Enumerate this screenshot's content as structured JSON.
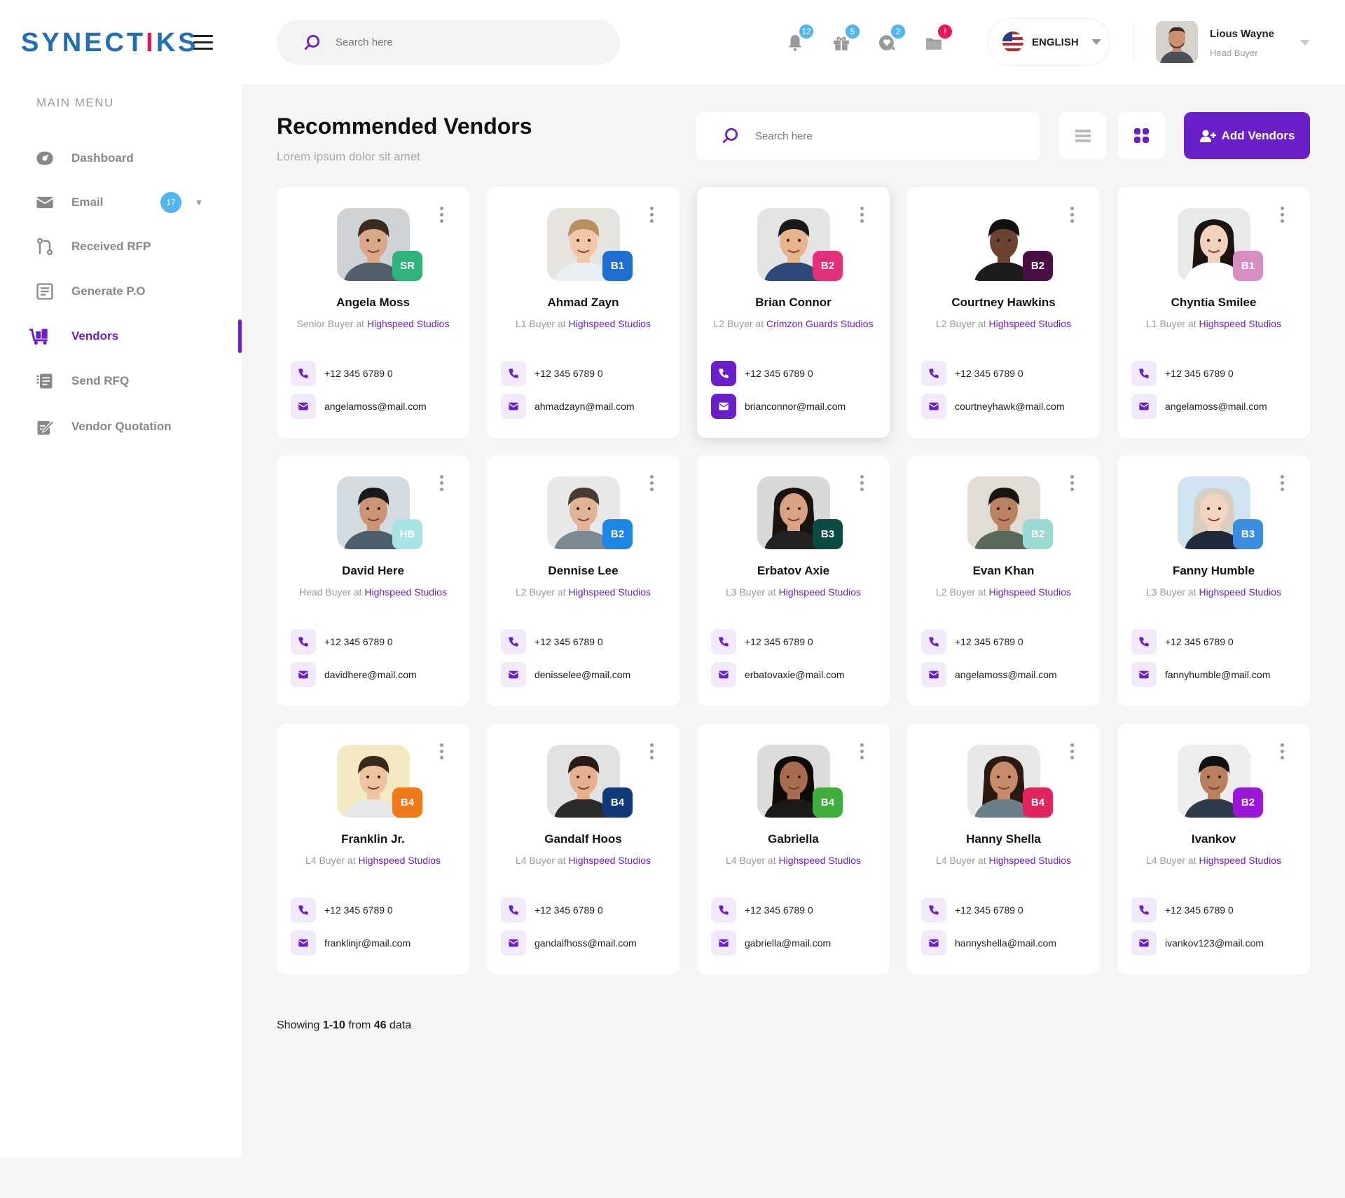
{
  "app": {
    "logo_main": "SYNECT",
    "logo_i": "I",
    "logo_tail": "KS"
  },
  "sidebar": {
    "menu_title": "MAIN MENU",
    "items": [
      {
        "label": "Dashboard",
        "icon": "dashboard-icon"
      },
      {
        "label": "Email",
        "icon": "email-icon",
        "badge": "17"
      },
      {
        "label": "Received RFP",
        "icon": "received-rfp-icon"
      },
      {
        "label": "Generate P.O",
        "icon": "generate-po-icon"
      },
      {
        "label": "Vendors",
        "icon": "vendors-icon",
        "active": true
      },
      {
        "label": "Send RFQ",
        "icon": "send-rfq-icon"
      },
      {
        "label": "Vendor Quotation",
        "icon": "vendor-quotation-icon"
      }
    ]
  },
  "header": {
    "search_placeholder": "Search here",
    "notifications": [
      {
        "icon": "bell-icon",
        "count": "12",
        "color": "#4fb7ee"
      },
      {
        "icon": "gift-icon",
        "count": "5",
        "color": "#4fb7ee"
      },
      {
        "icon": "heart-chat-icon",
        "count": "2",
        "color": "#4fb7ee"
      },
      {
        "icon": "folder-icon",
        "count": "!",
        "color": "#e6195d"
      }
    ],
    "language": "ENGLISH",
    "user": {
      "name": "Lious Wayne",
      "role": "Head Buyer"
    }
  },
  "page": {
    "title": "Recommended Vendors",
    "subtitle": "Lorem ipsum  dolor sit amet",
    "search_placeholder": "Search here",
    "add_button": "Add Vendors"
  },
  "vendors": [
    {
      "name": "Angela Moss",
      "role": "Senior Buyer  at",
      "company": "Highspeed Studios",
      "tier": "SR",
      "tier_color": "#2fb37a",
      "phone": "+12 345 6789 0",
      "email": "angelamoss@mail.com"
    },
    {
      "name": "Ahmad Zayn",
      "role": "L1 Buyer at",
      "company": "Highspeed Studios",
      "tier": "B1",
      "tier_color": "#1f6fd0",
      "phone": "+12 345 6789 0",
      "email": "ahmadzayn@mail.com"
    },
    {
      "name": "Brian Connor",
      "role": "L2 Buyer at",
      "company": "Crimzon Guards Studios",
      "tier": "B2",
      "tier_color": "#e2317a",
      "phone": "+12 345 6789 0",
      "email": "brianconnor@mail.com"
    },
    {
      "name": "Courtney Hawkins",
      "role": "L2 Buyer at",
      "company": "Highspeed Studios",
      "tier": "B2",
      "tier_color": "#4a1045",
      "phone": "+12 345 6789 0",
      "email": "courtneyhawk@mail.com"
    },
    {
      "name": "Chyntia Smilee",
      "role": "L1 Buyer at",
      "company": "Highspeed Studios",
      "tier": "B1",
      "tier_color": "#d78fc3",
      "phone": "+12 345 6789 0",
      "email": "angelamoss@mail.com"
    },
    {
      "name": "David Here",
      "role": "Head Buyer at",
      "company": "Highspeed Studios",
      "tier": "HB",
      "tier_color": "#a7e3e3",
      "phone": "+12 345 6789 0",
      "email": "davidhere@mail.com"
    },
    {
      "name": "Dennise Lee",
      "role": "L2 Buyer at",
      "company": "Highspeed Studios",
      "tier": "B2",
      "tier_color": "#1e86e6",
      "phone": "+12 345 6789 0",
      "email": "denisselee@mail.com"
    },
    {
      "name": "Erbatov Axie",
      "role": "L3 Buyer at",
      "company": "Highspeed Studios",
      "tier": "B3",
      "tier_color": "#0e4a44",
      "phone": "+12 345 6789 0",
      "email": "erbatovaxie@mail.com"
    },
    {
      "name": "Evan Khan",
      "role": "L2 Buyer at",
      "company": "Highspeed Studios",
      "tier": "B2",
      "tier_color": "#9ad8d2",
      "phone": "+12 345 6789 0",
      "email": "angelamoss@mail.com"
    },
    {
      "name": "Fanny Humble",
      "role": "L3 Buyer at",
      "company": "Highspeed Studios",
      "tier": "B3",
      "tier_color": "#3c8fe0",
      "phone": "+12 345 6789 0",
      "email": "fannyhumble@mail.com"
    },
    {
      "name": "Franklin Jr.",
      "role": "L4 Buyer at",
      "company": "Highspeed Studios",
      "tier": "B4",
      "tier_color": "#f07a1a",
      "phone": "+12 345 6789 0",
      "email": "franklinjr@mail.com"
    },
    {
      "name": "Gandalf Hoos",
      "role": "L4 Buyer at",
      "company": "Highspeed Studios",
      "tier": "B4",
      "tier_color": "#123a78",
      "phone": "+12 345 6789 0",
      "email": "gandalfhoss@mail.com"
    },
    {
      "name": "Gabriella",
      "role": "L4 Buyer at",
      "company": "Highspeed Studios",
      "tier": "B4",
      "tier_color": "#3fae3c",
      "phone": "+12 345 6789 0",
      "email": "gabriella@mail.com"
    },
    {
      "name": "Hanny Shella",
      "role": "L4 Buyer at",
      "company": "Highspeed Studios",
      "tier": "B4",
      "tier_color": "#e0245e",
      "phone": "+12 345 6789 0",
      "email": "hannyshella@mail.com"
    },
    {
      "name": "Ivankov",
      "role": "L4 Buyer at",
      "company": "Highspeed Studios",
      "tier": "B2",
      "tier_color": "#9a18d8",
      "phone": "+12 345 6789 0",
      "email": "ivankov123@mail.com"
    }
  ],
  "footer": {
    "showing_prefix": "Showing",
    "range": "1-10",
    "from_label": "from",
    "total": "46",
    "suffix": "data"
  },
  "colors": {
    "accent": "#6a1fc9",
    "brand_blue": "#1f6fb5",
    "brand_pink": "#e6195d"
  }
}
